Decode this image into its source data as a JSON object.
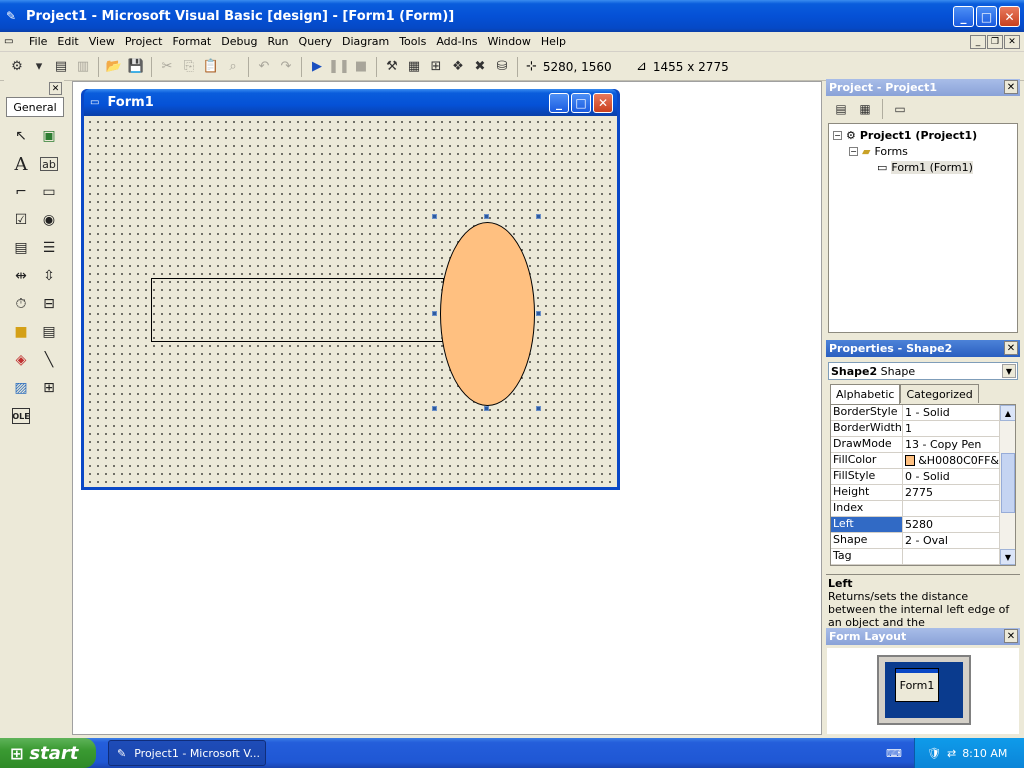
{
  "window": {
    "title": "Project1 - Microsoft Visual Basic [design] - [Form1 (Form)]"
  },
  "menu": [
    "File",
    "Edit",
    "View",
    "Project",
    "Format",
    "Debug",
    "Run",
    "Query",
    "Diagram",
    "Tools",
    "Add-Ins",
    "Window",
    "Help"
  ],
  "toolbar": {
    "position": "5280, 1560",
    "size": "1455 x 2775"
  },
  "toolbox": {
    "tab": "General"
  },
  "form": {
    "title": "Form1"
  },
  "project": {
    "title": "Project - Project1",
    "tree": {
      "root": "Project1 (Project1)",
      "folder": "Forms",
      "item": "Form1 (Form1)"
    }
  },
  "properties": {
    "title": "Properties - Shape2",
    "object_name": "Shape2",
    "object_type": "Shape",
    "tab_alpha": "Alphabetic",
    "tab_cat": "Categorized",
    "rows": [
      {
        "name": "BorderStyle",
        "value": "1 - Solid"
      },
      {
        "name": "BorderWidth",
        "value": "1"
      },
      {
        "name": "DrawMode",
        "value": "13 - Copy Pen"
      },
      {
        "name": "FillColor",
        "value": "&H0080C0FF&"
      },
      {
        "name": "FillStyle",
        "value": "0 - Solid"
      },
      {
        "name": "Height",
        "value": "2775"
      },
      {
        "name": "Index",
        "value": ""
      },
      {
        "name": "Left",
        "value": "5280"
      },
      {
        "name": "Shape",
        "value": "2 - Oval"
      },
      {
        "name": "Tag",
        "value": ""
      }
    ],
    "desc_title": "Left",
    "desc_text": "Returns/sets the distance between the internal left edge of an object and the"
  },
  "layout": {
    "title": "Form Layout",
    "form_label": "Form1"
  },
  "taskbar": {
    "start": "start",
    "task": "Project1 - Microsoft V...",
    "time": "8:10 AM"
  },
  "colors": {
    "fill": "#ffc080",
    "title_blue": "#0551d6"
  }
}
